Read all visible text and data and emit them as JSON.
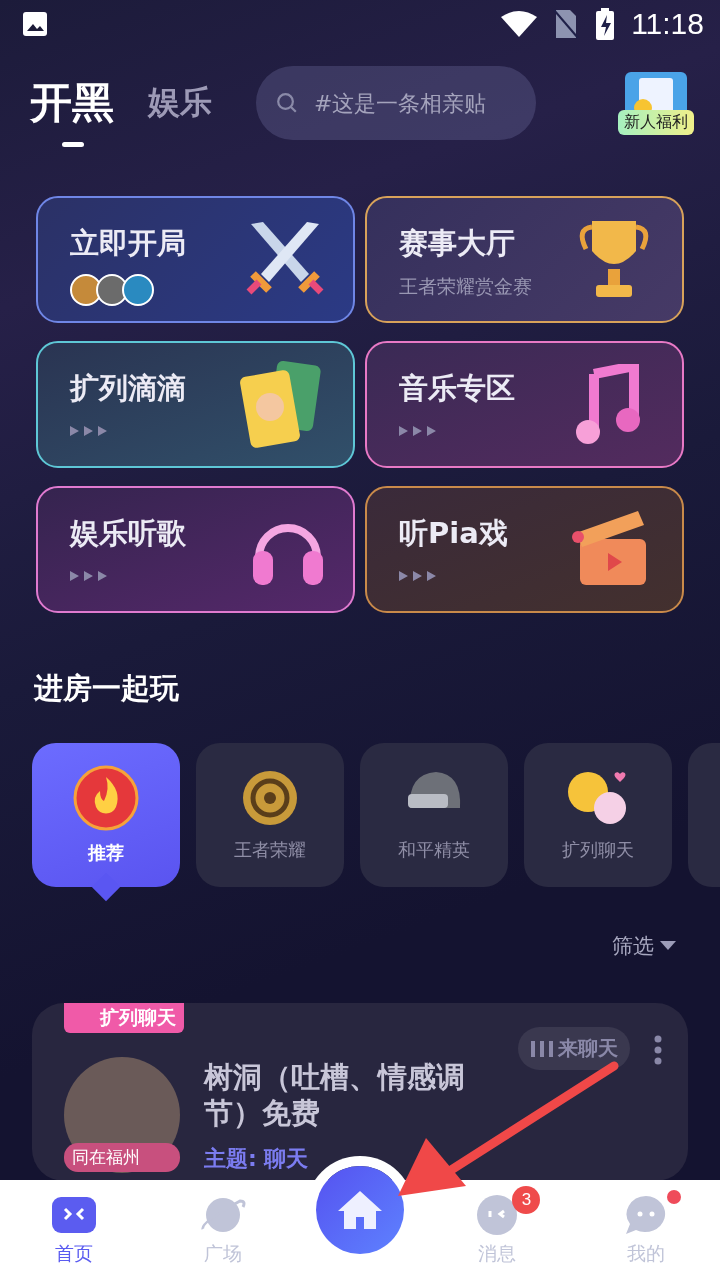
{
  "status_bar": {
    "time": "11:18"
  },
  "top_tabs": [
    {
      "label": "开黑",
      "selected": true
    },
    {
      "label": "娱乐",
      "selected": false
    }
  ],
  "search": {
    "placeholder": "#这是一条相亲贴"
  },
  "promo": {
    "label": "新人福利"
  },
  "feature_cards": [
    {
      "title": "立即开局",
      "kind": "avatars"
    },
    {
      "title": "赛事大厅",
      "kind": "subtitle",
      "subtitle": "王者荣耀赏金赛"
    },
    {
      "title": "扩列滴滴",
      "kind": "dots"
    },
    {
      "title": "音乐专区",
      "kind": "dots"
    },
    {
      "title": "娱乐听歌",
      "kind": "dots"
    },
    {
      "title": "听Pia戏",
      "kind": "dots"
    }
  ],
  "section_title": "进房一起玩",
  "categories": [
    {
      "label": "推荐",
      "selected": true
    },
    {
      "label": "王者荣耀",
      "selected": false
    },
    {
      "label": "和平精英",
      "selected": false
    },
    {
      "label": "扩列聊天",
      "selected": false
    }
  ],
  "filter": {
    "label": "筛选"
  },
  "room": {
    "tag": "扩列聊天",
    "location": "同在福州",
    "title": "树洞（吐槽、情感调节）免费",
    "topic": "主题: 聊天",
    "action": "来聊天"
  },
  "bottom_nav": [
    {
      "label": "首页",
      "selected": true
    },
    {
      "label": "广场",
      "selected": false
    },
    {
      "label": "消息",
      "selected": false,
      "badge": "3"
    },
    {
      "label": "我的",
      "selected": false,
      "dot": true
    }
  ]
}
